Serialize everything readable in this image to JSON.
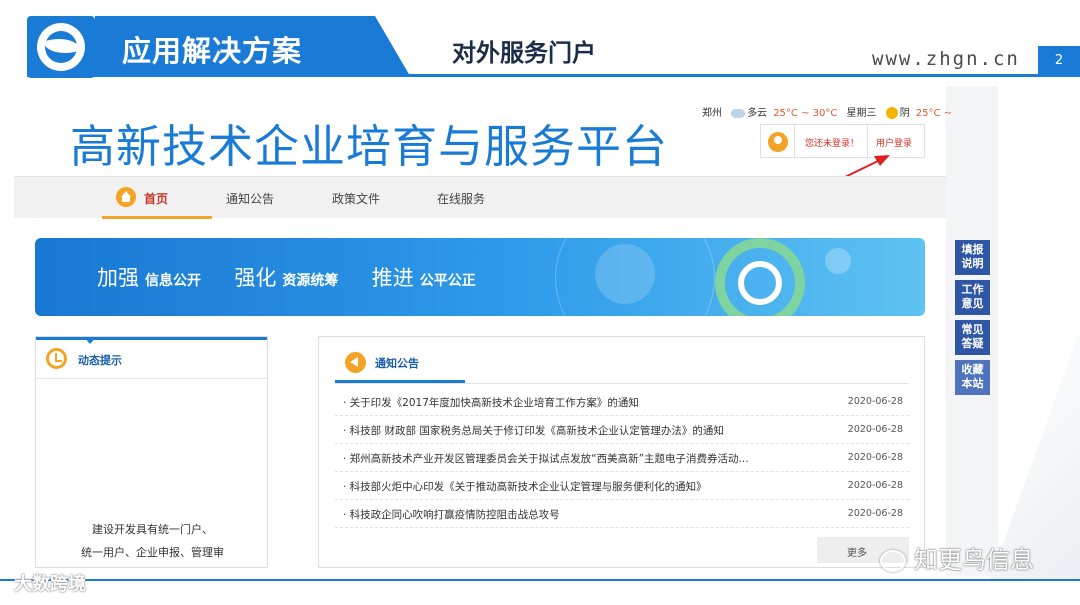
{
  "slide": {
    "section_title": "应用解决方案",
    "heading": "对外服务门户",
    "url": "www.zhgn.cn",
    "page_number": "2",
    "accent_color": "#1a7bd6"
  },
  "portal": {
    "title": "高新技术企业培育与服务平台",
    "weather": {
      "city": "郑州",
      "today_cond": "多云",
      "today_temp": "25°C ~ 30°C",
      "weekday": "星期三",
      "next_cond": "阴",
      "next_temp": "25°C ~"
    },
    "login": {
      "status": "您还未登录！",
      "button": "用户登录"
    },
    "nav": {
      "home": "首页",
      "items": [
        "通知公告",
        "政策文件",
        "在线服务"
      ]
    },
    "banner": {
      "p1_big": "加强",
      "p1_small": "信息公开",
      "p2_big": "强化",
      "p2_small": "资源统筹",
      "p3_big": "推进",
      "p3_small": "公平公正"
    },
    "dynamic": {
      "title": "动态提示",
      "line1": "建设开发具有统一门户、",
      "line2": "统一用户、企业申报、管理审"
    },
    "notices": {
      "title": "通知公告",
      "items": [
        {
          "text": "· 关于印发《2017年度加快高新技术企业培育工作方案》的通知",
          "date": "2020-06-28"
        },
        {
          "text": "· 科技部 财政部 国家税务总局关于修订印发《高新技术企业认定管理办法》的通知",
          "date": "2020-06-28"
        },
        {
          "text": "· 郑州高新技术产业开发区管理委员会关于拟试点发放“西美高新”主题电子消费券活动...",
          "date": "2020-06-28"
        },
        {
          "text": "· 科技部火炬中心印发《关于推动高新技术企业认定管理与服务便利化的通知》",
          "date": "2020-06-28"
        },
        {
          "text": "· 科技政企同心吹响打赢疫情防控阻击战总攻号",
          "date": "2020-06-28"
        }
      ],
      "more": "更多"
    },
    "side_buttons": [
      "填报说明",
      "工作意见",
      "常见答疑",
      "收藏本站"
    ]
  },
  "watermarks": {
    "left": "大数跨境",
    "right": "知更鸟信息"
  }
}
